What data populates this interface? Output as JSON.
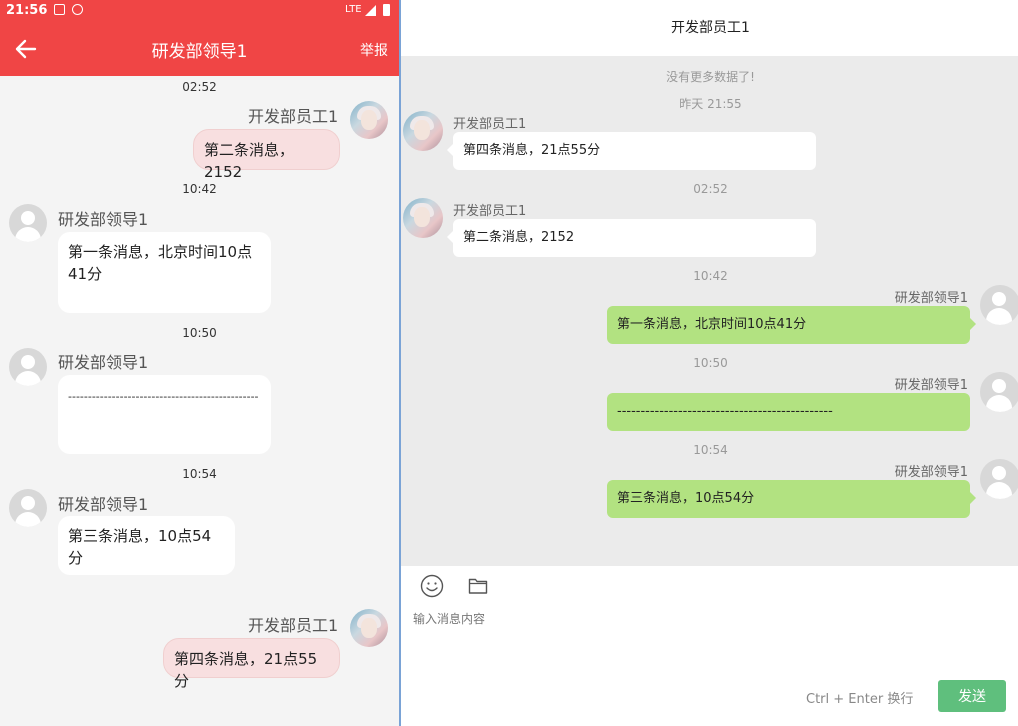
{
  "phone": {
    "status_bar": {
      "time": "21:56",
      "network": "LTE"
    },
    "app_bar": {
      "title": "研发部领导1",
      "action": "举报"
    },
    "colors": {
      "app_bar": "#f04545",
      "outgoing_bubble": "#f8dfe0",
      "incoming_bubble": "#ffffff"
    },
    "messages": [
      {
        "time": "02:52",
        "sender": "开发部员工1",
        "text": "第二条消息，2152",
        "side": "right"
      },
      {
        "time": "10:42",
        "sender": "研发部领导1",
        "text": "第一条消息，北京时间10点41分",
        "side": "left"
      },
      {
        "time": "10:50",
        "sender": "研发部领导1",
        "text": "------------------------------------------------",
        "side": "left"
      },
      {
        "time": "10:54",
        "sender": "研发部领导1",
        "text": "第三条消息，10点54分",
        "side": "left"
      },
      {
        "time": "",
        "sender": "开发部员工1",
        "text": "第四条消息，21点55分",
        "side": "right"
      }
    ]
  },
  "desktop": {
    "title": "开发部员工1",
    "no_more": "没有更多数据了!",
    "colors": {
      "outgoing_bubble": "#b2e281",
      "incoming_bubble": "#ffffff",
      "send_button": "#5fbf7d"
    },
    "messages": [
      {
        "time": "昨天 21:55",
        "sender": "开发部员工1",
        "text": "第四条消息，21点55分",
        "side": "left"
      },
      {
        "time": "02:52",
        "sender": "开发部员工1",
        "text": "第二条消息，2152",
        "side": "left"
      },
      {
        "time": "10:42",
        "sender": "研发部领导1",
        "text": "第一条消息，北京时间10点41分",
        "side": "right"
      },
      {
        "time": "10:50",
        "sender": "研发部领导1",
        "text": "----------------------------------------------",
        "side": "right"
      },
      {
        "time": "10:54",
        "sender": "研发部领导1",
        "text": "第三条消息，10点54分",
        "side": "right"
      }
    ],
    "composer": {
      "placeholder": "输入消息内容",
      "hint": "Ctrl + Enter 换行",
      "send_label": "发送",
      "icons": [
        "emoji-icon",
        "folder-icon"
      ]
    }
  }
}
